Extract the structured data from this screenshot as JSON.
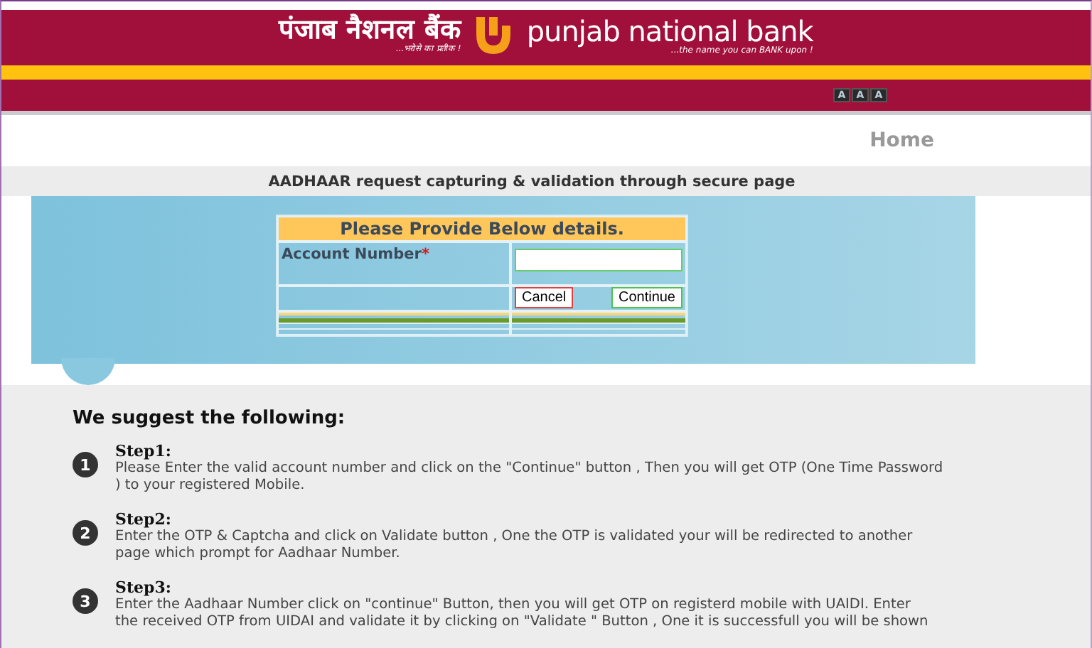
{
  "header": {
    "hindi_name": "पंजाब नैशनल बैंक",
    "hindi_tagline": "...भरोसे का प्रतीक !",
    "english_name": "punjab national bank",
    "english_tagline": "...the name you can BANK upon !",
    "font_size_buttons": [
      "A",
      "A",
      "A"
    ]
  },
  "nav": {
    "home_link": "Home"
  },
  "page_title": "AADHAAR request capturing & validation through secure page",
  "form": {
    "heading": "Please Provide Below details.",
    "field_label": "Account Number",
    "required_mark": "*",
    "buttons": [
      {
        "label": "Cancel",
        "kind": "cancel"
      },
      {
        "label": "Continue",
        "kind": "continue"
      }
    ]
  },
  "suggestions": {
    "heading": "We suggest the following:",
    "steps": [
      {
        "number": "1",
        "title": "Step1:",
        "lines": [
          "Please Enter the valid account number and click on the \"Continue\" button , Then you will get OTP (One Time Password",
          ") to your registered Mobile."
        ]
      },
      {
        "number": "2",
        "title": "Step2:",
        "lines": [
          "Enter the OTP  & Captcha and click on Validate button , One the OTP is validated your will be redirected to  another",
          "page which prompt for Aadhaar Number."
        ]
      },
      {
        "number": "3",
        "title": "Step3:",
        "lines": [
          "Enter the Aadhaar Number click on \"continue\" Button, then you will get OTP on  registerd mobile with UAIDI. Enter",
          "the received OTP from UIDAI and validate it by clicking on \"Validate \" Button , One it is successfull you will be shown"
        ]
      }
    ]
  }
}
